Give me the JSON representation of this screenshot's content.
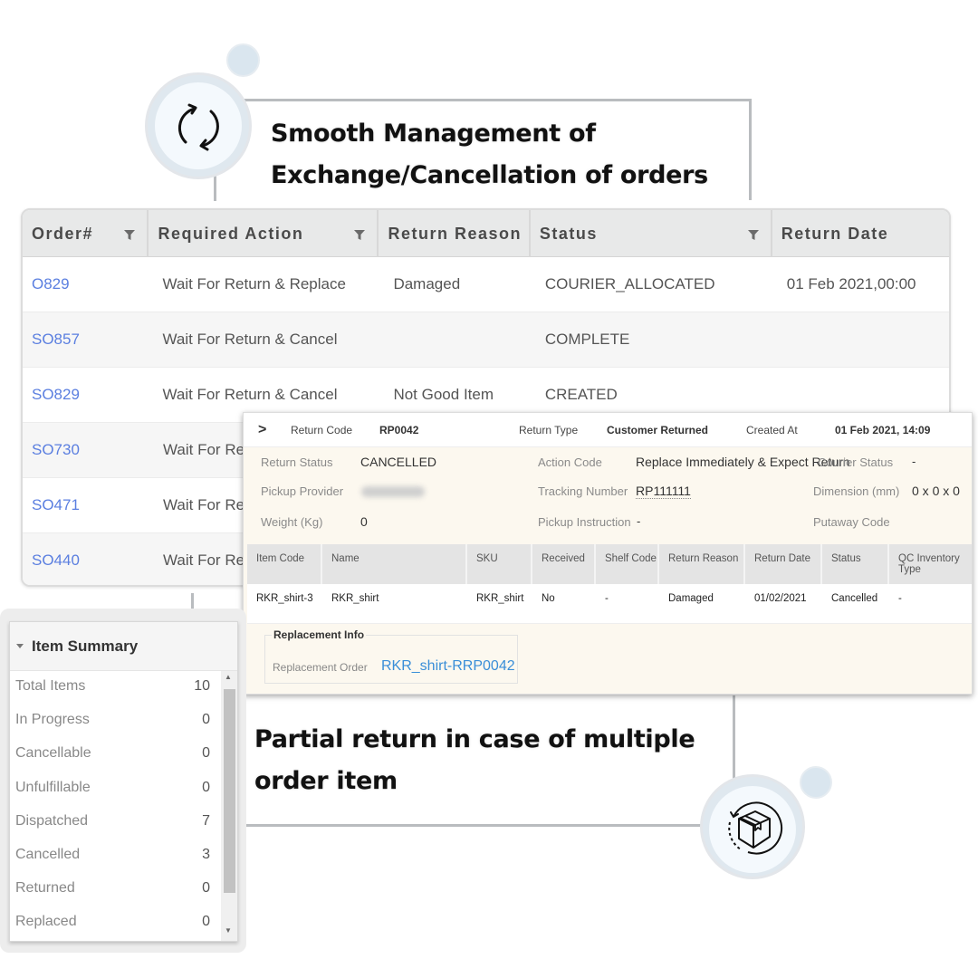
{
  "features": {
    "top": {
      "line1": "Smooth Management of",
      "line2": "Exchange/Cancellation of orders",
      "icon": "refresh-icon"
    },
    "bottom": {
      "line1": "Partial return in case of multiple",
      "line2": "order item",
      "icon": "box-return-icon"
    }
  },
  "orders_table": {
    "columns": [
      {
        "label": "Order#",
        "filter": true
      },
      {
        "label": "Required Action",
        "filter": true
      },
      {
        "label": "Return Reason",
        "filter": false
      },
      {
        "label": "Status",
        "filter": true
      },
      {
        "label": "Return Date",
        "filter": false
      }
    ],
    "rows": [
      {
        "order": "O829",
        "action": "Wait For Return & Replace",
        "reason": "Damaged",
        "status": "COURIER_ALLOCATED",
        "date": "01 Feb 2021,00:00"
      },
      {
        "order": "SO857",
        "action": "Wait For Return & Cancel",
        "reason": "",
        "status": "COMPLETE",
        "date": ""
      },
      {
        "order": "SO829",
        "action": "Wait For Return & Cancel",
        "reason": "Not Good Item",
        "status": "CREATED",
        "date": ""
      },
      {
        "order": "SO730",
        "action": "Wait For Re",
        "reason": "",
        "status": "",
        "date": ""
      },
      {
        "order": "SO471",
        "action": "Wait For Re",
        "reason": "",
        "status": "",
        "date": ""
      },
      {
        "order": "SO440",
        "action": "Wait For Re",
        "reason": "",
        "status": "",
        "date": ""
      }
    ]
  },
  "return_panel": {
    "header": {
      "expand_icon": ">",
      "return_code_label": "Return Code",
      "return_code": "RP0042",
      "return_type_label": "Return Type",
      "return_type": "Customer Returned",
      "created_at_label": "Created At",
      "created_at": "01 Feb 2021, 14:09"
    },
    "details": {
      "return_status_label": "Return Status",
      "return_status": "CANCELLED",
      "pickup_provider_label": "Pickup Provider",
      "weight_label": "Weight (Kg)",
      "weight": "0",
      "action_code_label": "Action Code",
      "action_code": "Replace Immediately & Expect Return",
      "tracking_label": "Tracking Number",
      "tracking": "RP111111",
      "pickup_instruction_label": "Pickup Instruction",
      "pickup_instruction": "-",
      "courier_status_label": "Courier Status",
      "courier_status": "-",
      "dimension_label": "Dimension (mm)",
      "dimension": "0 x 0 x 0",
      "putaway_label": "Putaway Code"
    },
    "items": {
      "columns": [
        "Item Code",
        "Name",
        "SKU",
        "Received",
        "Shelf Code",
        "Return Reason",
        "Return Date",
        "Status",
        "QC Inventory Type"
      ],
      "rows": [
        [
          "RKR_shirt-3",
          "RKR_shirt",
          "RKR_shirt",
          "No",
          "-",
          "Damaged",
          "01/02/2021",
          "Cancelled",
          "-"
        ]
      ]
    },
    "replacement": {
      "title": "Replacement Info",
      "order_label": "Replacement Order",
      "order": "RKR_shirt-RRP0042"
    }
  },
  "item_summary": {
    "title": "Item Summary",
    "rows": [
      {
        "label": "Total Items",
        "value": "10"
      },
      {
        "label": "In Progress",
        "value": "0"
      },
      {
        "label": "Cancellable",
        "value": "0"
      },
      {
        "label": "Unfulfillable",
        "value": "0"
      },
      {
        "label": "Dispatched",
        "value": "7"
      },
      {
        "label": "Cancelled",
        "value": "3"
      },
      {
        "label": "Returned",
        "value": "0"
      },
      {
        "label": "Replaced",
        "value": "0"
      }
    ]
  }
}
